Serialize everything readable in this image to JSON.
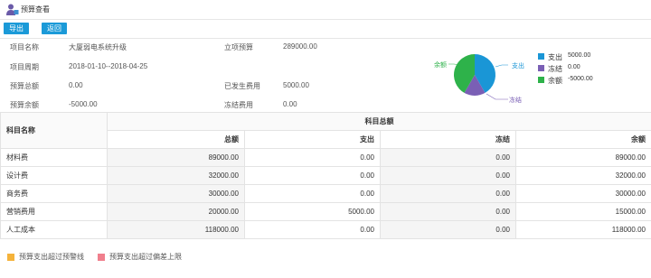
{
  "page": {
    "title": "预算查看"
  },
  "toolbar": {
    "export_label": "导出",
    "back_label": "返回"
  },
  "info": {
    "project_name_label": "项目名称",
    "project_name": "大厦弱电系统升级",
    "approved_budget_label": "立项预算",
    "approved_budget": "289000.00",
    "project_period_label": "项目周期",
    "project_period": "2018-01-10--2018-04-25",
    "budget_total_label": "预算总额",
    "budget_total": "0.00",
    "incurred_label": "已发生费用",
    "incurred": "5000.00",
    "budget_balance_label": "预算余额",
    "budget_balance": "-5000.00",
    "frozen_label": "冻结费用",
    "frozen": "0.00"
  },
  "chart_data": {
    "type": "pie",
    "categories": [
      "支出",
      "冻结",
      "余额"
    ],
    "values": [
      5000.0,
      0.0,
      -5000.0
    ],
    "value_labels": [
      "5000.00",
      "0.00",
      "-5000.00"
    ],
    "colors": [
      "#1a96d6",
      "#7a5fb5",
      "#2eb24a"
    ],
    "legend": "right"
  },
  "table": {
    "col_name": "科目名称",
    "group_header": "科目总额",
    "headers": [
      "总额",
      "支出",
      "冻结",
      "余额"
    ],
    "rows": [
      {
        "name": "材料费",
        "total": "89000.00",
        "spend": "0.00",
        "frozen": "0.00",
        "balance": "89000.00"
      },
      {
        "name": "设计费",
        "total": "32000.00",
        "spend": "0.00",
        "frozen": "0.00",
        "balance": "32000.00"
      },
      {
        "name": "商务费",
        "total": "30000.00",
        "spend": "0.00",
        "frozen": "0.00",
        "balance": "30000.00"
      },
      {
        "name": "营销费用",
        "total": "20000.00",
        "spend": "5000.00",
        "frozen": "0.00",
        "balance": "15000.00"
      },
      {
        "name": "人工成本",
        "total": "118000.00",
        "spend": "0.00",
        "frozen": "0.00",
        "balance": "118000.00"
      }
    ]
  },
  "footer": {
    "legend1": {
      "label": "预算支出超过预警线",
      "color": "#f5b33b"
    },
    "legend2": {
      "label": "预算支出超过偏差上限",
      "color": "#f07f8d"
    }
  }
}
